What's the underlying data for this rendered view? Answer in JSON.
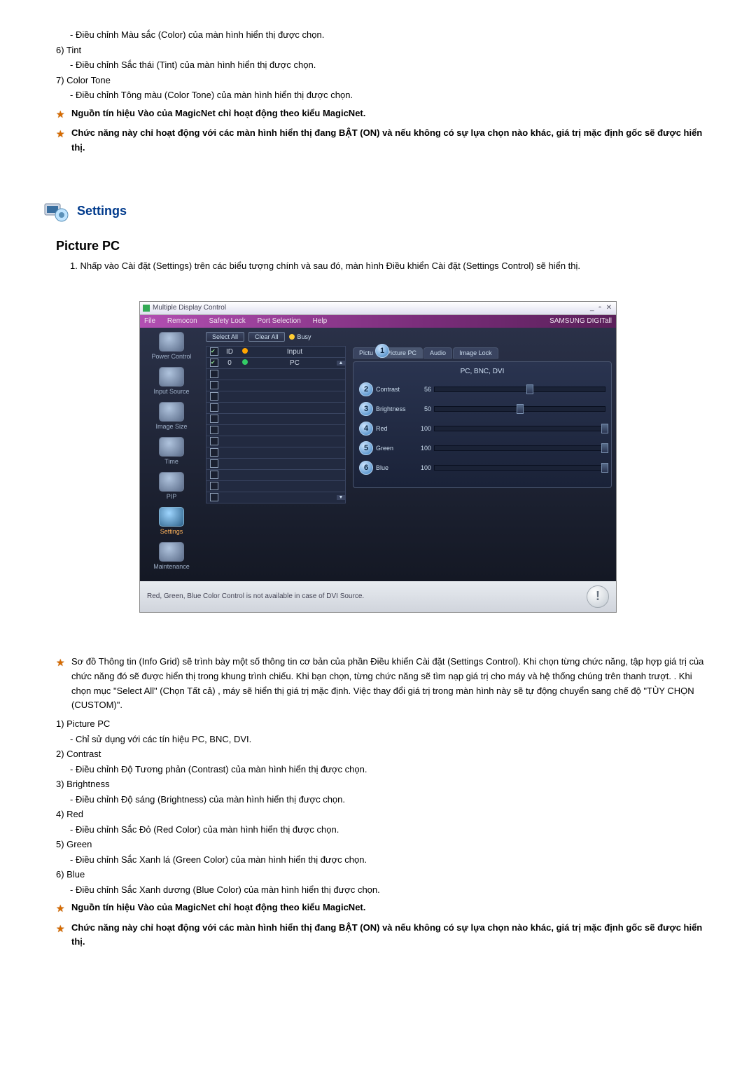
{
  "prev_list": {
    "color_sub": "- Điều chỉnh Màu sắc (Color) của màn hình hiển thị được chọn.",
    "item6": "6)  Tint",
    "item6_sub": "- Điều chỉnh Sắc thái (Tint) của màn hình hiển thị được chọn.",
    "item7": "7)  Color Tone",
    "item7_sub": "- Điều chỉnh Tông màu (Color Tone) của màn hình hiển thị được chọn."
  },
  "star_notes_top": [
    "Nguồn tín hiệu Vào của MagicNet chỉ hoạt động theo kiểu MagicNet.",
    "Chức năng này chỉ hoạt động với các màn hình hiển thị đang BẬT (ON) và nếu không có sự lựa chọn nào khác, giá trị mặc định gốc sẽ được hiển thị."
  ],
  "settings_heading": "Settings",
  "section_title": "Picture PC",
  "instruction": "1.  Nhấp vào Cài đặt (Settings) trên các biểu tượng chính và sau đó, màn hình Điều khiển Cài đặt (Settings Control) sẽ hiển thị.",
  "app": {
    "title": "Multiple Display Control",
    "win_controls": "_ ▫ ✕",
    "menus": [
      "File",
      "Remocon",
      "Safety Lock",
      "Port Selection",
      "Help"
    ],
    "brand": "SAMSUNG DIGITall",
    "sidebar": [
      {
        "label": "Power Control"
      },
      {
        "label": "Input Source"
      },
      {
        "label": "Image Size"
      },
      {
        "label": "Time"
      },
      {
        "label": "PIP"
      },
      {
        "label": "Settings",
        "active": true
      },
      {
        "label": "Maintenance"
      }
    ],
    "buttons": {
      "select_all": "Select All",
      "clear_all": "Clear All",
      "busy": "Busy"
    },
    "grid": {
      "headers": {
        "chk": "",
        "id": "ID",
        "st": "",
        "input": "Input"
      },
      "row0": {
        "id": "0",
        "input": "PC",
        "checked": true
      }
    },
    "tabs": [
      "Pictu",
      "Picture PC",
      "Audio",
      "Image Lock"
    ],
    "active_tab_badge": "1",
    "panel_title": "PC, BNC, DVI",
    "sliders": [
      {
        "n": "2",
        "label": "Contrast",
        "val": "56",
        "pct": 56,
        "color": "cyan"
      },
      {
        "n": "3",
        "label": "Brightness",
        "val": "50",
        "pct": 50,
        "color": "cyan"
      },
      {
        "n": "4",
        "label": "Red",
        "val": "100",
        "pct": 100,
        "color": "red"
      },
      {
        "n": "5",
        "label": "Green",
        "val": "100",
        "pct": 100,
        "color": "green"
      },
      {
        "n": "6",
        "label": "Blue",
        "val": "100",
        "pct": 100,
        "color": "blue"
      }
    ],
    "footer_note": "Red, Green, Blue Color Control is not available in case of DVI Source.",
    "footer_icon": "!"
  },
  "star_intro": "Sơ đồ Thông tin (Info Grid) sẽ trình bày một số thông tin cơ bản của phần Điều khiển Cài đặt (Settings Control). Khi chọn từng chức năng, tập hợp giá trị của chức năng đó sẽ được hiển thị trong khung trình chiếu. Khi bạn chọn, từng chức năng sẽ tìm nạp giá trị cho máy và hệ thống chúng trên thanh trượt. . Khi chọn mục \"Select All\" (Chọn Tất cả) , máy sẽ hiển thị giá trị mặc định. Việc thay đổi giá trị trong màn hình này sẽ tự động chuyển sang chế độ \"TÙY CHỌN (CUSTOM)\".",
  "items": [
    {
      "h": "1)  Picture PC",
      "d": "- Chỉ sử dụng với các tín hiệu PC, BNC, DVI."
    },
    {
      "h": "2)  Contrast",
      "d": "- Điều chỉnh Độ Tương phản (Contrast) của màn hình hiển thị được chọn."
    },
    {
      "h": "3)  Brightness",
      "d": "- Điều chỉnh Độ sáng (Brightness) của màn hình hiển thị được chọn."
    },
    {
      "h": "4)  Red",
      "d": "- Điều chỉnh Sắc Đỏ (Red Color) của màn hình hiển thị được chọn."
    },
    {
      "h": "5)  Green",
      "d": "- Điều chỉnh Sắc Xanh lá (Green Color) của màn hình hiển thị được chọn."
    },
    {
      "h": "6)  Blue",
      "d": "- Điều chỉnh Sắc Xanh dương (Blue Color) của màn hình hiển thị được chọn."
    }
  ],
  "star_notes_bottom": [
    "Nguồn tín hiệu Vào của MagicNet chỉ hoạt động theo kiểu MagicNet.",
    "Chức năng này chỉ hoạt động với các màn hình hiển thị đang BẬT (ON) và nếu không có sự lựa chọn nào khác, giá trị mặc định gốc sẽ được hiển thị."
  ]
}
